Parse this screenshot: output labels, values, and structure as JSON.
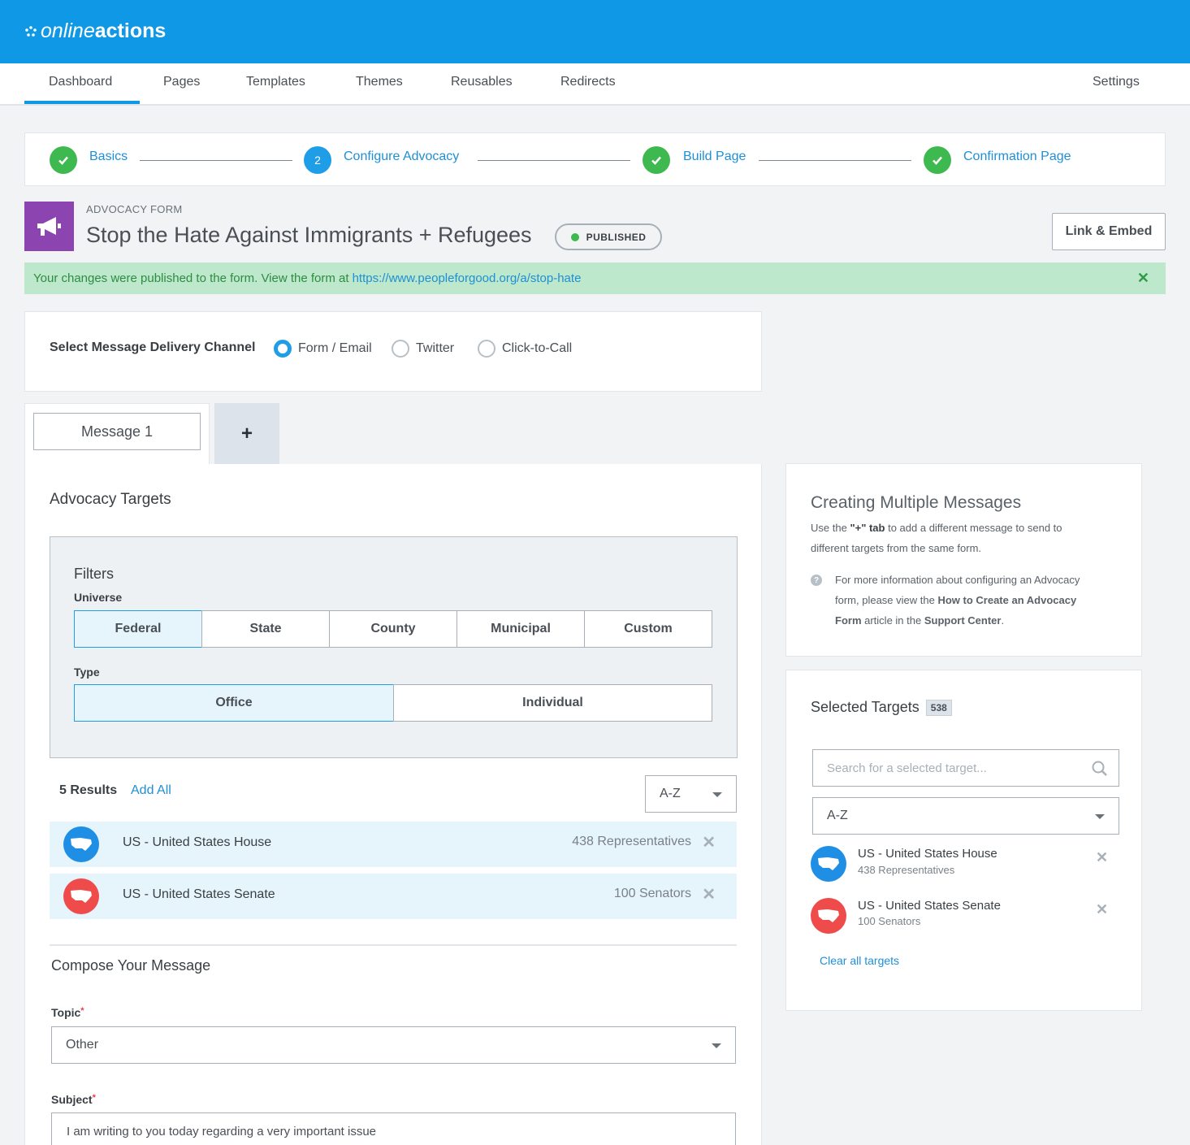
{
  "app": {
    "logo_light": "online",
    "logo_bold": "actions"
  },
  "nav": {
    "items": [
      "Dashboard",
      "Pages",
      "Templates",
      "Themes",
      "Reusables",
      "Redirects"
    ],
    "settings": "Settings",
    "active": "Dashboard"
  },
  "stepper": {
    "steps": [
      {
        "label": "Basics",
        "state": "done",
        "marker": ""
      },
      {
        "label": "Configure Advocacy",
        "state": "current",
        "marker": "2"
      },
      {
        "label": "Build Page",
        "state": "done",
        "marker": ""
      },
      {
        "label": "Confirmation Page",
        "state": "done",
        "marker": ""
      }
    ]
  },
  "form": {
    "type_label": "ADVOCACY FORM",
    "title": "Stop the Hate Against Immigrants + Refugees",
    "status": "PUBLISHED",
    "link_embed": "Link & Embed",
    "icon": "megaphone-icon",
    "icon_color": "#8c44b0"
  },
  "alert": {
    "text": "Your changes were published to the form. View the form at",
    "url": "https://www.peopleforgood.org/a/stop-hate"
  },
  "channel": {
    "label": "Select Message Delivery Channel",
    "options": [
      "Form / Email",
      "Twitter",
      "Click-to-Call"
    ],
    "selected": "Form / Email"
  },
  "tabs": {
    "message_1": "Message 1",
    "add": "+"
  },
  "targets": {
    "title": "Advocacy Targets",
    "filters_title": "Filters",
    "universe_label": "Universe",
    "universe_options": [
      "Federal",
      "State",
      "County",
      "Municipal",
      "Custom"
    ],
    "universe_selected": "Federal",
    "type_label": "Type",
    "type_options": [
      "Office",
      "Individual"
    ],
    "type_selected": "Office",
    "results_count": "5 Results",
    "add_all": "Add All",
    "sort": "A-Z",
    "results": [
      {
        "name": "US - United States House",
        "count": "438 Representatives",
        "color": "#1f8fe5"
      },
      {
        "name": "US - United States Senate",
        "count": "100 Senators",
        "color": "#ef4b4b"
      }
    ]
  },
  "compose": {
    "title": "Compose Your Message",
    "topic_label": "Topic",
    "topic_value": "Other",
    "subject_label": "Subject",
    "required_mark": "*",
    "subject_value": "I am writing to you today regarding a very important issue"
  },
  "help": {
    "title": "Creating Multiple Messages",
    "text_1": "Use the",
    "text_plus": "\"+\" tab",
    "text_2": "to add a different message to send to different targets from the same form.",
    "more_1": "For more information about configuring an Advocacy form, please view the",
    "more_link": "How to Create an Advocacy Form",
    "more_2": "article in the",
    "more_support": "Support Center",
    "more_end": "."
  },
  "selected": {
    "title": "Selected Targets",
    "count": "538",
    "search_placeholder": "Search for a selected target...",
    "sort": "A-Z",
    "items": [
      {
        "name": "US - United States House",
        "sub": "438 Representatives"
      },
      {
        "name": "US - United States Senate",
        "sub": "100 Senators"
      }
    ],
    "clear_all": "Clear all targets"
  },
  "colors": {
    "brand": "#0f98e5",
    "success": "#3db94f",
    "link": "#1f8fd6"
  }
}
